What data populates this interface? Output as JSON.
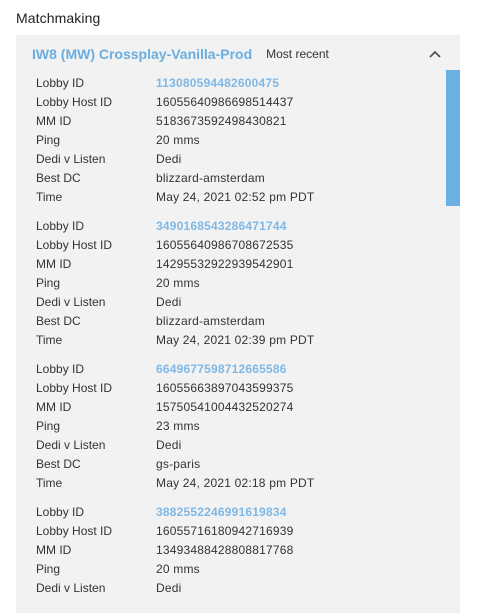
{
  "section": {
    "title": "Matchmaking"
  },
  "panel": {
    "title": "IW8 (MW) Crossplay-Vanilla-Prod",
    "subtitle": "Most recent"
  },
  "labels": {
    "lobby_id": "Lobby ID",
    "lobby_host_id": "Lobby Host ID",
    "mm_id": "MM ID",
    "ping": "Ping",
    "dedi": "Dedi v Listen",
    "best_dc": "Best DC",
    "time": "Time"
  },
  "entries": [
    {
      "lobby_id": "113080594482600475",
      "lobby_host_id": "16055640986698514437",
      "mm_id": "5183673592498430821",
      "ping": "20 mms",
      "dedi": "Dedi",
      "best_dc": "blizzard-amsterdam",
      "time": "May 24, 2021 02:52 pm PDT"
    },
    {
      "lobby_id": "3490168543286471744",
      "lobby_host_id": "16055640986708672535",
      "mm_id": "14295532922939542901",
      "ping": "20 mms",
      "dedi": "Dedi",
      "best_dc": "blizzard-amsterdam",
      "time": "May 24, 2021 02:39 pm PDT"
    },
    {
      "lobby_id": "6649677598712665586",
      "lobby_host_id": "16055663897043599375",
      "mm_id": "15750541004432520274",
      "ping": "23 mms",
      "dedi": "Dedi",
      "best_dc": "gs-paris",
      "time": "May 24, 2021 02:18 pm PDT"
    },
    {
      "lobby_id": "3882552246991619834",
      "lobby_host_id": "16055716180942716939",
      "mm_id": "13493488428808817768",
      "ping": "20 mms",
      "dedi": "Dedi"
    }
  ],
  "icons": {
    "collapse": "chevron-up-icon"
  },
  "colors": {
    "accent": "#6aaee0",
    "link": "#7fb8e6",
    "scrollbar": "#6ab0e4",
    "panel_bg": "#f2f2f2"
  }
}
